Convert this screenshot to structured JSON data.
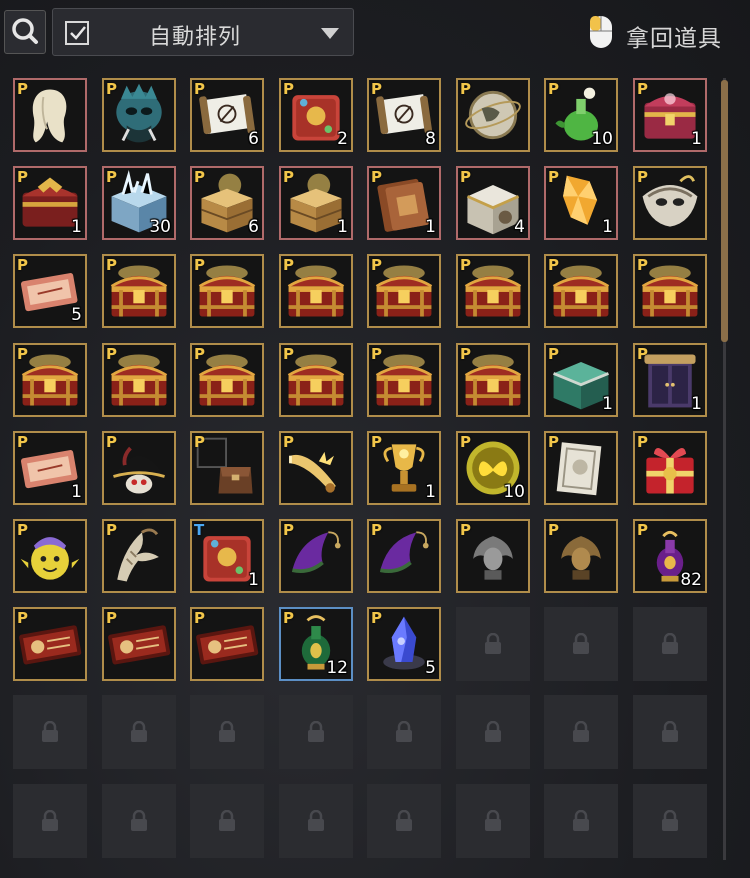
{
  "toolbar": {
    "search_icon": "search-icon",
    "auto_sort_checked": true,
    "auto_sort_label": "自動排列",
    "retrieve_label": "拿回道具"
  },
  "colors": {
    "frame_gold": "#b08d4a",
    "frame_red": "#b06a6a",
    "frame_blue": "#5c8fc5",
    "scroll_thumb": "#8b6f49"
  },
  "inventory": {
    "rows": [
      [
        {
          "tag": "P",
          "icon": "white-hair-icon",
          "frame": "red",
          "count": ""
        },
        {
          "tag": "P",
          "icon": "dark-mask-icon",
          "frame": "gold",
          "count": ""
        },
        {
          "tag": "P",
          "icon": "scroll-icon",
          "frame": "gold",
          "count": "6"
        },
        {
          "tag": "P",
          "icon": "red-pouch-icon",
          "frame": "gold",
          "count": "2"
        },
        {
          "tag": "P",
          "icon": "scroll-icon",
          "frame": "gold",
          "count": "8"
        },
        {
          "tag": "P",
          "icon": "globe-icon",
          "frame": "gold",
          "count": ""
        },
        {
          "tag": "P",
          "icon": "green-potion-icon",
          "frame": "gold",
          "count": "10"
        },
        {
          "tag": "P",
          "icon": "pink-chest-icon",
          "frame": "red",
          "count": "1"
        }
      ],
      [
        {
          "tag": "P",
          "icon": "dragon-chest-icon",
          "frame": "red",
          "count": "1"
        },
        {
          "tag": "P",
          "icon": "crystal-box-icon",
          "frame": "red",
          "count": "30"
        },
        {
          "tag": "P",
          "icon": "gold-box-icon",
          "frame": "red",
          "count": "6"
        },
        {
          "tag": "P",
          "icon": "gold-box-icon",
          "frame": "red",
          "count": "1"
        },
        {
          "tag": "P",
          "icon": "book-icon",
          "frame": "red",
          "count": "1"
        },
        {
          "tag": "P",
          "icon": "silver-box-icon",
          "frame": "red",
          "count": "4"
        },
        {
          "tag": "P",
          "icon": "gold-gem-icon",
          "frame": "red",
          "count": "1"
        },
        {
          "tag": "P",
          "icon": "silver-mask-icon",
          "frame": "gold",
          "count": ""
        }
      ],
      [
        {
          "tag": "P",
          "icon": "ticket-icon",
          "frame": "gold",
          "count": "5"
        },
        {
          "tag": "P",
          "icon": "treasure-chest-icon",
          "frame": "gold",
          "count": ""
        },
        {
          "tag": "P",
          "icon": "treasure-chest-icon",
          "frame": "gold",
          "count": ""
        },
        {
          "tag": "P",
          "icon": "treasure-chest-icon",
          "frame": "gold",
          "count": ""
        },
        {
          "tag": "P",
          "icon": "treasure-chest-icon",
          "frame": "gold",
          "count": ""
        },
        {
          "tag": "P",
          "icon": "treasure-chest-icon",
          "frame": "gold",
          "count": ""
        },
        {
          "tag": "P",
          "icon": "treasure-chest-icon",
          "frame": "gold",
          "count": ""
        },
        {
          "tag": "P",
          "icon": "treasure-chest-icon",
          "frame": "gold",
          "count": ""
        }
      ],
      [
        {
          "tag": "P",
          "icon": "treasure-chest-icon",
          "frame": "gold",
          "count": ""
        },
        {
          "tag": "P",
          "icon": "treasure-chest-icon",
          "frame": "gold",
          "count": ""
        },
        {
          "tag": "P",
          "icon": "treasure-chest-icon",
          "frame": "gold",
          "count": ""
        },
        {
          "tag": "P",
          "icon": "treasure-chest-icon",
          "frame": "gold",
          "count": ""
        },
        {
          "tag": "P",
          "icon": "treasure-chest-icon",
          "frame": "gold",
          "count": ""
        },
        {
          "tag": "P",
          "icon": "treasure-chest-icon",
          "frame": "gold",
          "count": ""
        },
        {
          "tag": "P",
          "icon": "jade-chest-icon",
          "frame": "gold",
          "count": "1"
        },
        {
          "tag": "P",
          "icon": "wardrobe-icon",
          "frame": "gold",
          "count": "1"
        }
      ],
      [
        {
          "tag": "P",
          "icon": "ticket-icon",
          "frame": "gold",
          "count": "1"
        },
        {
          "tag": "P",
          "icon": "pirate-hat-icon",
          "frame": "gold",
          "count": ""
        },
        {
          "tag": "P",
          "icon": "bag-icon",
          "frame": "gold",
          "count": ""
        },
        {
          "tag": "P",
          "icon": "horn-icon",
          "frame": "gold",
          "count": ""
        },
        {
          "tag": "P",
          "icon": "trophy-icon",
          "frame": "gold",
          "count": "1"
        },
        {
          "tag": "P",
          "icon": "butterfly-orb-icon",
          "frame": "gold",
          "count": "10"
        },
        {
          "tag": "P",
          "icon": "document-icon",
          "frame": "gold",
          "count": ""
        },
        {
          "tag": "P",
          "icon": "gift-box-icon",
          "frame": "gold",
          "count": ""
        }
      ],
      [
        {
          "tag": "P",
          "icon": "yellow-face-icon",
          "frame": "gold",
          "count": ""
        },
        {
          "tag": "P",
          "icon": "bone-wings-icon",
          "frame": "gold",
          "count": ""
        },
        {
          "tag": "T",
          "icon": "red-pouch-icon",
          "frame": "gold",
          "count": "1"
        },
        {
          "tag": "P",
          "icon": "purple-hat-icon",
          "frame": "gold",
          "count": ""
        },
        {
          "tag": "P",
          "icon": "purple-hat-icon",
          "frame": "gold",
          "count": ""
        },
        {
          "tag": "P",
          "icon": "gray-statue-icon",
          "frame": "gold",
          "count": ""
        },
        {
          "tag": "P",
          "icon": "bronze-statue-icon",
          "frame": "gold",
          "count": ""
        },
        {
          "tag": "P",
          "icon": "purple-vase-icon",
          "frame": "gold",
          "count": "82"
        }
      ],
      [
        {
          "tag": "P",
          "icon": "coupon-icon",
          "frame": "gold",
          "count": ""
        },
        {
          "tag": "P",
          "icon": "coupon-icon",
          "frame": "gold",
          "count": ""
        },
        {
          "tag": "P",
          "icon": "coupon-icon",
          "frame": "gold",
          "count": ""
        },
        {
          "tag": "P",
          "icon": "green-vase-icon",
          "frame": "blue",
          "count": "12"
        },
        {
          "tag": "P",
          "icon": "blue-crystal-icon",
          "frame": "gold",
          "count": "5"
        },
        {
          "locked": true
        },
        {
          "locked": true
        },
        {
          "locked": true
        }
      ],
      [
        {
          "locked": true
        },
        {
          "locked": true
        },
        {
          "locked": true
        },
        {
          "locked": true
        },
        {
          "locked": true
        },
        {
          "locked": true
        },
        {
          "locked": true
        },
        {
          "locked": true
        }
      ],
      [
        {
          "locked": true
        },
        {
          "locked": true
        },
        {
          "locked": true
        },
        {
          "locked": true
        },
        {
          "locked": true
        },
        {
          "locked": true
        },
        {
          "locked": true
        },
        {
          "locked": true
        }
      ]
    ]
  }
}
